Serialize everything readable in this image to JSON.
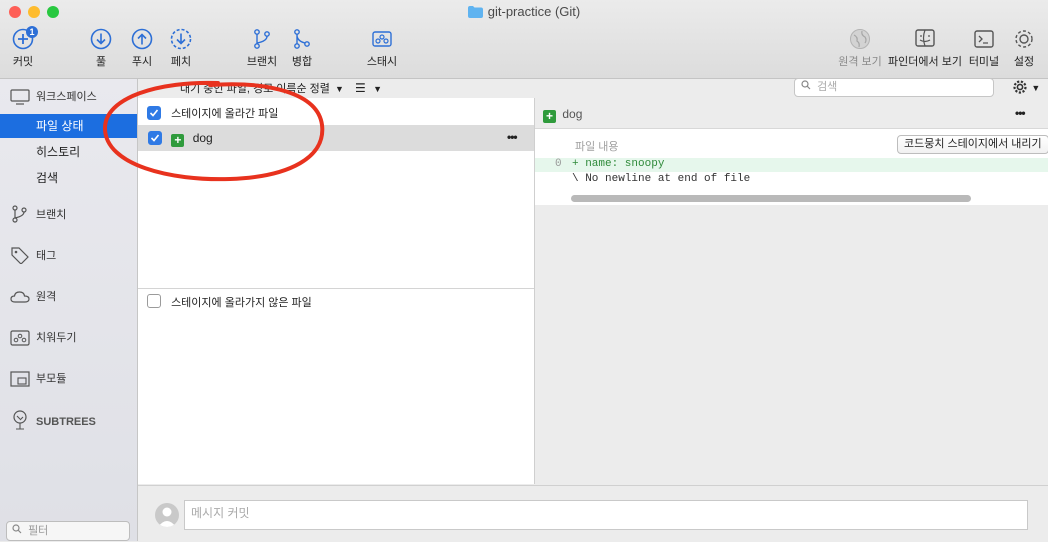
{
  "window": {
    "title": "git-practice (Git)"
  },
  "toolbar": {
    "commit": "커밋",
    "commit_badge": "1",
    "pull": "풀",
    "push": "푸시",
    "fetch": "페치",
    "branch": "브랜치",
    "merge": "병합",
    "stash": "스태시",
    "remote_view": "원격 보기",
    "show_in_finder": "파인더에서 보기",
    "terminal": "터미널",
    "settings": "설정"
  },
  "sidebar": {
    "workspace": "워크스페이스",
    "file_status": "파일 상태",
    "history": "히스토리",
    "search": "검색",
    "branches": "브랜치",
    "tags": "태그",
    "remotes": "원격",
    "stashes": "치워두기",
    "submodules": "부모듈",
    "subtrees": "SUBTREES",
    "filter_placeholder": "필터"
  },
  "subbar": {
    "sort_label": "대기 중인 파일, 경로 이름순 정렬",
    "search_placeholder": "검색"
  },
  "files": {
    "staged_header": "스테이지에 올라간 파일",
    "staged_items": [
      {
        "name": "dog",
        "status": "added",
        "checked": true
      }
    ],
    "unstaged_header": "스테이지에 올라가지 않은 파일",
    "more": "•••"
  },
  "diff": {
    "file_name": "dog",
    "hunk_label": "파일 내용",
    "unstage_button": "코드뭉치 스테이지에서 내리기",
    "line_number": "0",
    "added_line": "+ name: snoopy",
    "no_newline": "\\  No newline at end of file",
    "more": "•••"
  },
  "commit": {
    "message_placeholder": "메시지 커밋"
  },
  "colors": {
    "accent": "#1c6ee0",
    "added": "#2f9b3c",
    "annotation": "#e8321e"
  }
}
